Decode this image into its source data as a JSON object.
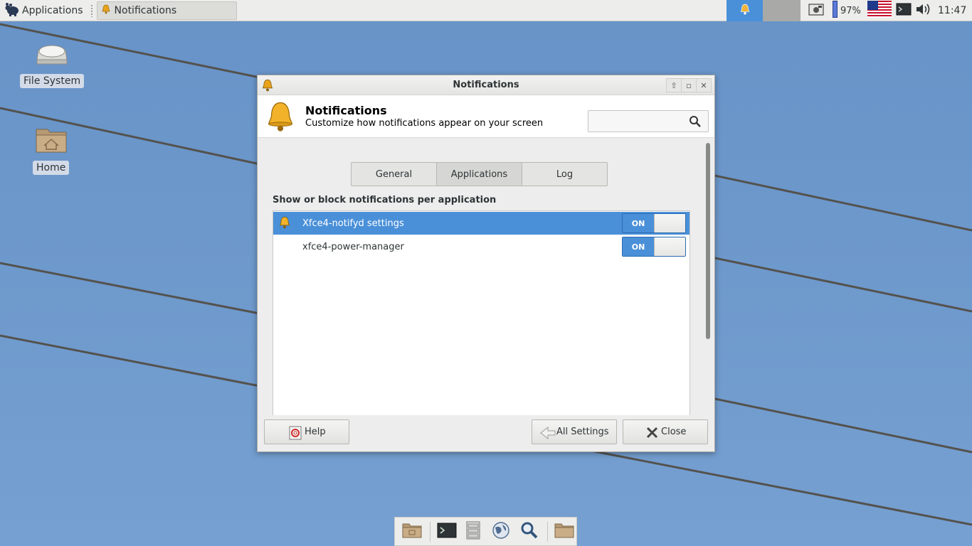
{
  "panel": {
    "applications_label": "Applications",
    "task_label": "Notifications",
    "battery_percent": "97%",
    "clock": "11:47"
  },
  "desktop": {
    "icons": [
      {
        "label": "File System",
        "icon": "hard-drive-icon"
      },
      {
        "label": "Home",
        "icon": "home-folder-icon"
      }
    ]
  },
  "window": {
    "title": "Notifications",
    "header_title": "Notifications",
    "header_subtitle": "Customize how notifications appear on your screen",
    "search_value": "",
    "tabs": [
      {
        "label": "General",
        "active": false
      },
      {
        "label": "Applications",
        "active": true
      },
      {
        "label": "Log",
        "active": false
      }
    ],
    "section_label": "Show or block notifications per application",
    "apps": [
      {
        "name": "Xfce4-notifyd settings",
        "state": "ON",
        "selected": true
      },
      {
        "name": "xfce4-power-manager",
        "state": "ON",
        "selected": false
      }
    ],
    "buttons": {
      "help": "Help",
      "all_settings": "All Settings",
      "close": "Close"
    }
  },
  "colors": {
    "accent": "#4a90d9",
    "panel_bg": "#ededeb",
    "desktop_bg": "#6a93c9"
  }
}
